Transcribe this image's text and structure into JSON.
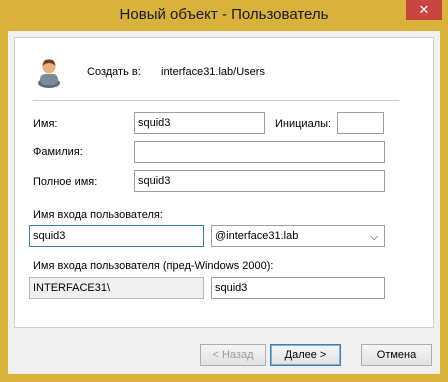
{
  "window": {
    "title": "Новый объект - Пользователь",
    "close_label": "✕"
  },
  "header": {
    "create_in_label": "Создать в:",
    "create_in_path": "interface31.lab/Users",
    "icon": "user-icon"
  },
  "form": {
    "first_name_label": "Имя:",
    "first_name_value": "squid3",
    "initials_label": "Инициалы:",
    "initials_value": "",
    "last_name_label": "Фамилия:",
    "last_name_value": "",
    "full_name_label": "Полное имя:",
    "full_name_value": "squid3",
    "logon_name_label": "Имя входа пользователя:",
    "logon_name_value": "squid3",
    "domain_suffix_value": "@interface31.lab",
    "pre2000_label": "Имя входа пользователя (пред-Windows 2000):",
    "pre2000_domain_value": "INTERFACE31\\",
    "pre2000_name_value": "squid3"
  },
  "buttons": {
    "back_label": "< Назад",
    "next_label": "Далее >",
    "cancel_label": "Отмена"
  }
}
